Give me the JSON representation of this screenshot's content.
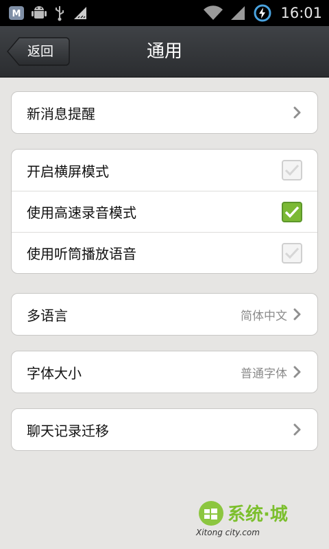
{
  "status_bar": {
    "time": "16:01",
    "icons_left": [
      "m-app-icon",
      "android-icon",
      "usb-icon",
      "ruler-icon"
    ],
    "icons_right": [
      "wifi-icon",
      "signal-icon",
      "battery-charging-icon"
    ]
  },
  "header": {
    "back_label": "返回",
    "title": "通用"
  },
  "settings": {
    "new_message": {
      "label": "新消息提醒"
    },
    "landscape": {
      "label": "开启横屏模式",
      "checked": false
    },
    "fast_record": {
      "label": "使用高速录音模式",
      "checked": true
    },
    "earpiece": {
      "label": "使用听筒播放语音",
      "checked": false
    },
    "language": {
      "label": "多语言",
      "value": "简体中文"
    },
    "font_size": {
      "label": "字体大小",
      "value": "普通字体"
    },
    "chat_migrate": {
      "label": "聊天记录迁移"
    }
  },
  "watermark": {
    "text": "系统·城",
    "sub": "Xitong city.com"
  },
  "colors": {
    "accent_check": "#7bb934",
    "title_bar": "#34373a",
    "background": "#e6e5e3"
  }
}
